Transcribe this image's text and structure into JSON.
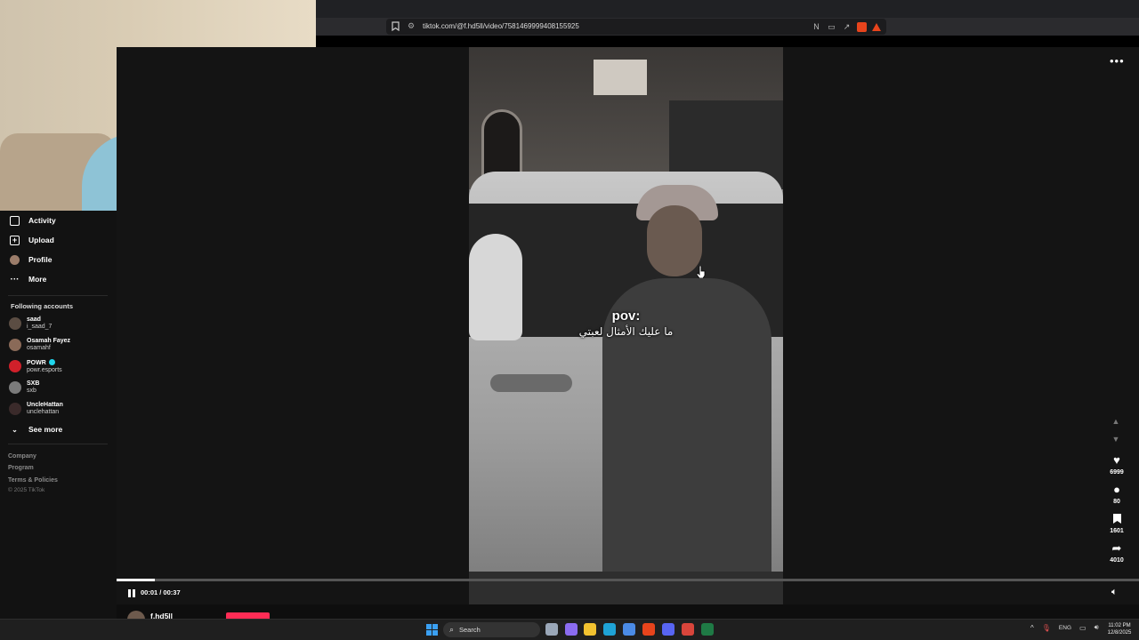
{
  "browser": {
    "url": "tiktok.com/@f.hd5ll/video/7581469999408155925",
    "site_info_icon": "tune-icon",
    "bookmark_icon": "bookmark-icon",
    "toolbar_icons": [
      "reader-mode-icon",
      "cast-icon",
      "share-icon",
      "brave-shields-icon",
      "brave-rewards-icon"
    ]
  },
  "webcam": {
    "description_icon": "webcam-feed"
  },
  "sidebar": {
    "nav": [
      {
        "label": "Activity",
        "icon": "inbox-icon"
      },
      {
        "label": "Upload",
        "icon": "plus-box-icon"
      },
      {
        "label": "Profile",
        "icon": "avatar-icon"
      },
      {
        "label": "More",
        "icon": "ellipsis-icon"
      }
    ],
    "following_title": "Following accounts",
    "accounts": [
      {
        "name": "saad",
        "handle": "i_saad_7",
        "verified": false,
        "color": "#5b4d43"
      },
      {
        "name": "Osamah Fayez",
        "handle": "osamahf",
        "verified": false,
        "color": "#8a6a58"
      },
      {
        "name": "POWR",
        "handle": "powr.esports",
        "verified": true,
        "color": "#d0202a"
      },
      {
        "name": "SXB",
        "handle": "sxb",
        "verified": false,
        "color": "#7a7a7a"
      },
      {
        "name": "UncleHattan",
        "handle": "unclehattan",
        "verified": false,
        "color": "#3a2a2a"
      }
    ],
    "see_more": "See more",
    "footer_links": [
      "Company",
      "Program",
      "Terms & Policies"
    ],
    "copyright": "© 2025 TikTok"
  },
  "video": {
    "caption_line1": "pov:",
    "caption_line2": "ما عليك الأمثال لعبتي",
    "time": "00:01 / 00:37",
    "progress": 0.037,
    "author": "f.hd5ll"
  },
  "actions": {
    "more_label": "•••",
    "likes": "6999",
    "comments": "80",
    "bookmarks": "1601",
    "shares": "4010"
  },
  "taskbar": {
    "search_placeholder": "Search",
    "language": "ENG",
    "time": "11:02 PM",
    "date": "12/8/2025",
    "apps": [
      {
        "name": "task-view-icon",
        "color": "#9aa7b8"
      },
      {
        "name": "copilot-icon",
        "color": "#8b6cf0"
      },
      {
        "name": "file-explorer-icon",
        "color": "#f2c230"
      },
      {
        "name": "edge-icon",
        "color": "#1fa3d6"
      },
      {
        "name": "store-icon",
        "color": "#4b8be6"
      },
      {
        "name": "brave-icon",
        "color": "#e8441c"
      },
      {
        "name": "discord-icon",
        "color": "#5865f2"
      },
      {
        "name": "chrome-icon",
        "color": "#d9453b"
      },
      {
        "name": "excel-icon",
        "color": "#1f7a45"
      }
    ]
  }
}
